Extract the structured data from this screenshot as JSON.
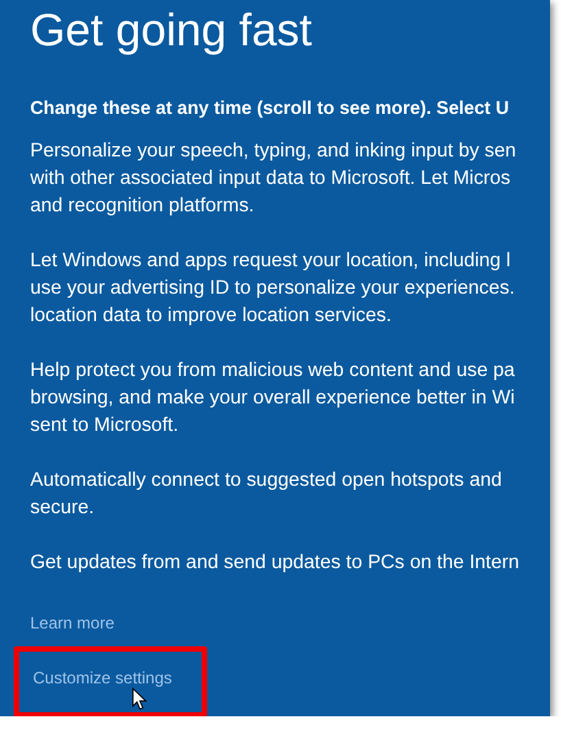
{
  "title": "Get going fast",
  "intro": "Change these at any time (scroll to see more). Select U",
  "paragraphs": [
    {
      "lines": [
        "Personalize your speech, typing, and inking input by sen",
        "with other associated input data to Microsoft. Let Micros",
        "and recognition platforms."
      ]
    },
    {
      "lines": [
        "Let Windows and apps request your location, including l",
        "use your advertising ID to personalize your experiences.",
        "location data to improve location services."
      ]
    },
    {
      "lines": [
        "Help protect you from malicious web content and use pa",
        "browsing, and make your overall experience better in Wi",
        "sent to Microsoft."
      ]
    },
    {
      "lines": [
        "Automatically connect to suggested open hotspots and",
        "secure."
      ]
    },
    {
      "lines": [
        "Get updates from and send updates to PCs on the Intern"
      ]
    }
  ],
  "links": [
    {
      "label": "Learn more",
      "highlighted": false
    },
    {
      "label": "Customize settings",
      "highlighted": true
    }
  ]
}
